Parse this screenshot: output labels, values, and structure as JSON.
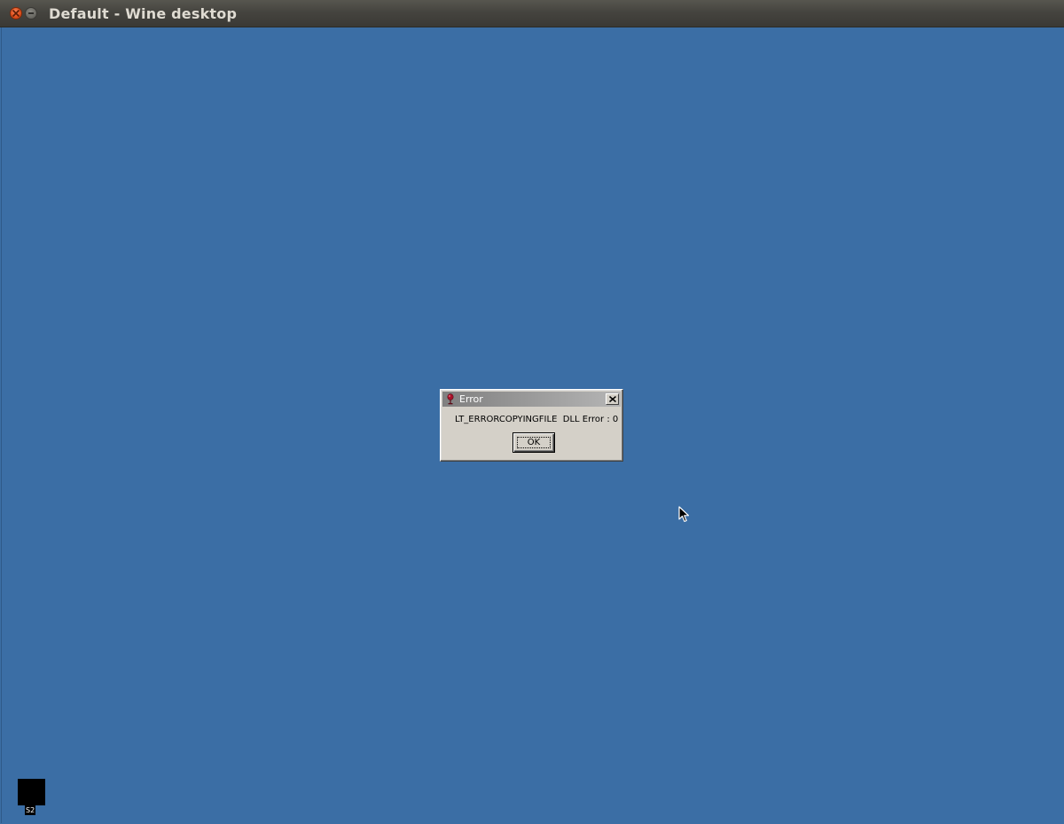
{
  "window": {
    "title": "Default - Wine desktop"
  },
  "dialog": {
    "title": "Error",
    "message": "LT_ERRORCOPYINGFILE  DLL Error : 0",
    "ok_label": "OK"
  },
  "desktop": {
    "background_color": "#3b6ea5",
    "icons": [
      {
        "label": "S2",
        "icon": "application-icon"
      }
    ]
  },
  "colors": {
    "titlebar": "#45443f",
    "title_text": "#dfdbd2",
    "dialog_face": "#d4d0c8",
    "close_button": "#e0501d"
  }
}
